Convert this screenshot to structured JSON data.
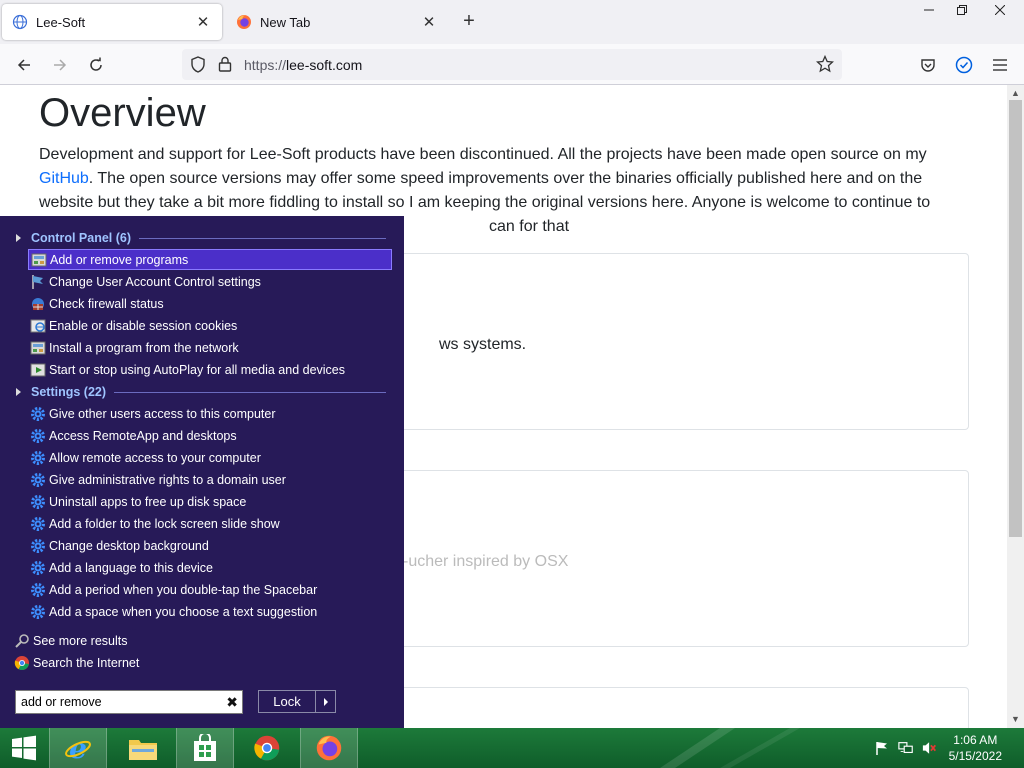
{
  "browser": {
    "tabs": [
      {
        "label": "Lee-Soft",
        "active": true,
        "icon": "globe-icon"
      },
      {
        "label": "New Tab",
        "active": false,
        "icon": "firefox-icon"
      }
    ],
    "new_tab_symbol": "+",
    "tab_close_symbol": "✕",
    "address": {
      "protocol": "https://",
      "host": "lee-soft.com"
    }
  },
  "page": {
    "heading": "Overview",
    "intro_before_link": "Development and support for Lee-Soft products have been discontinued. All the projects have been made open source on my ",
    "intro_link": "GitHub",
    "intro_after_link": ". The open source versions may offer some speed improvements over the binaries officially published here and on the website but they take a bit more fiddling to install so I am keeping the original versions here. Anyone is welcome to continue to",
    "intro_visible_tail": "can for that",
    "card1_visible_text": "ws systems.",
    "card2_visible_text": "-ucher inspired by OSX"
  },
  "start_menu": {
    "groups": [
      {
        "label": "Control Panel (6)",
        "items": [
          {
            "label": "Add or remove programs",
            "icon": "programs-icon",
            "selected": true
          },
          {
            "label": "Change User Account Control settings",
            "icon": "uac-flag-icon"
          },
          {
            "label": "Check firewall status",
            "icon": "firewall-icon"
          },
          {
            "label": "Enable or disable session cookies",
            "icon": "internet-options-icon"
          },
          {
            "label": "Install a program from the network",
            "icon": "programs-icon"
          },
          {
            "label": "Start or stop using AutoPlay for all media and devices",
            "icon": "autoplay-icon"
          }
        ]
      },
      {
        "label": "Settings (22)",
        "items": [
          {
            "label": "Give other users access to this computer",
            "icon": "gear-icon"
          },
          {
            "label": "Access RemoteApp and desktops",
            "icon": "gear-icon"
          },
          {
            "label": "Allow remote access to your computer",
            "icon": "gear-icon"
          },
          {
            "label": "Give administrative rights to a domain user",
            "icon": "gear-icon"
          },
          {
            "label": "Uninstall apps to free up disk space",
            "icon": "gear-icon"
          },
          {
            "label": "Add a folder to the lock screen slide show",
            "icon": "gear-icon"
          },
          {
            "label": "Change desktop background",
            "icon": "gear-icon"
          },
          {
            "label": "Add a language to this device",
            "icon": "gear-icon"
          },
          {
            "label": "Add a period when you double-tap the Spacebar",
            "icon": "gear-icon"
          },
          {
            "label": "Add a space when you choose a text suggestion",
            "icon": "gear-icon"
          }
        ]
      }
    ],
    "see_more": "See more results",
    "search_internet": "Search the Internet",
    "search_value": "add or remove",
    "clear_symbol": "✖",
    "lock_label": "Lock"
  },
  "taskbar": {
    "apps": [
      "internet-explorer-icon",
      "file-explorer-icon",
      "store-icon",
      "chrome-icon",
      "firefox-icon"
    ],
    "time": "1:06 AM",
    "date": "5/15/2022"
  },
  "colors": {
    "start_menu_bg": "#271a58",
    "selected_item": "#4b2fc9",
    "group_header": "#9fc4ff",
    "taskbar": "#0f5d2a",
    "link": "#0d6efd"
  }
}
